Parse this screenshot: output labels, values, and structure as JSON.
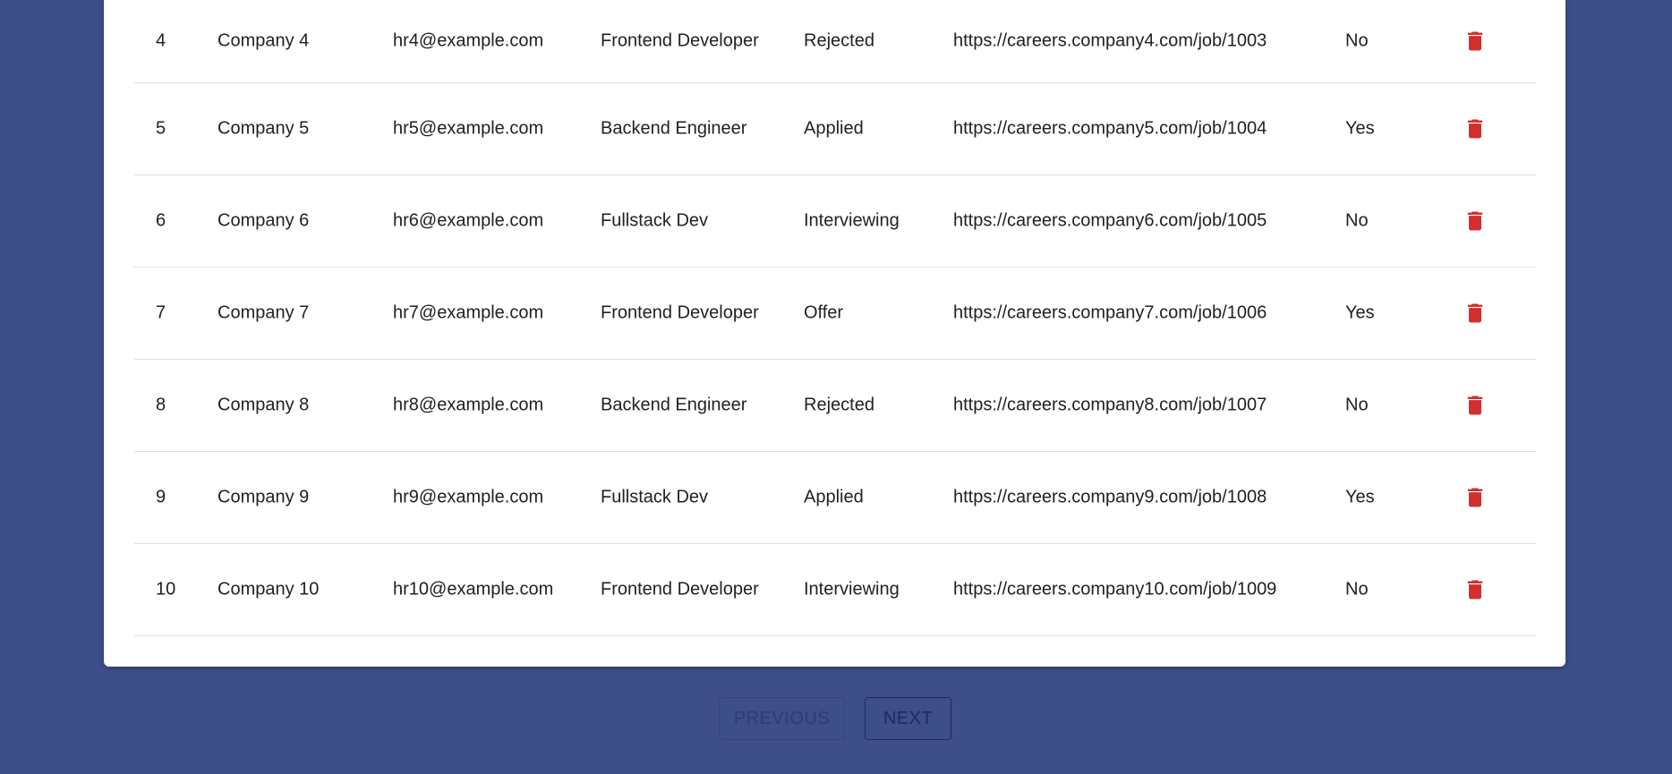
{
  "colors": {
    "background": "#3d4e88",
    "card": "#ffffff",
    "delete_icon": "#d32f2f",
    "divider": "#e0e0e0"
  },
  "rows": [
    {
      "id": "4",
      "company": "Company 4",
      "email": "hr4@example.com",
      "role": "Frontend Developer",
      "status": "Rejected",
      "url": "https://careers.company4.com/job/1003",
      "remote": "No",
      "action_icon": "delete-icon"
    },
    {
      "id": "5",
      "company": "Company 5",
      "email": "hr5@example.com",
      "role": "Backend Engineer",
      "status": "Applied",
      "url": "https://careers.company5.com/job/1004",
      "remote": "Yes",
      "action_icon": "delete-icon"
    },
    {
      "id": "6",
      "company": "Company 6",
      "email": "hr6@example.com",
      "role": "Fullstack Dev",
      "status": "Interviewing",
      "url": "https://careers.company6.com/job/1005",
      "remote": "No",
      "action_icon": "delete-icon"
    },
    {
      "id": "7",
      "company": "Company 7",
      "email": "hr7@example.com",
      "role": "Frontend Developer",
      "status": "Offer",
      "url": "https://careers.company7.com/job/1006",
      "remote": "Yes",
      "action_icon": "delete-icon"
    },
    {
      "id": "8",
      "company": "Company 8",
      "email": "hr8@example.com",
      "role": "Backend Engineer",
      "status": "Rejected",
      "url": "https://careers.company8.com/job/1007",
      "remote": "No",
      "action_icon": "delete-icon"
    },
    {
      "id": "9",
      "company": "Company 9",
      "email": "hr9@example.com",
      "role": "Fullstack Dev",
      "status": "Applied",
      "url": "https://careers.company9.com/job/1008",
      "remote": "Yes",
      "action_icon": "delete-icon"
    },
    {
      "id": "10",
      "company": "Company 10",
      "email": "hr10@example.com",
      "role": "Frontend Developer",
      "status": "Interviewing",
      "url": "https://careers.company10.com/job/1009",
      "remote": "No",
      "action_icon": "delete-icon"
    }
  ],
  "pagination": {
    "previous_label": "PREVIOUS",
    "previous_disabled": true,
    "next_label": "NEXT"
  }
}
